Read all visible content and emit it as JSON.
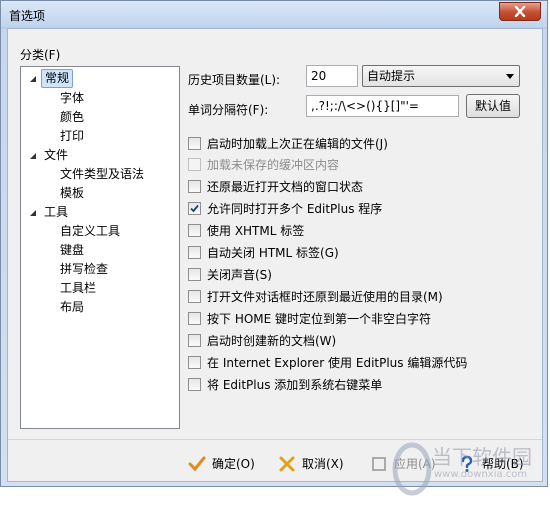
{
  "window": {
    "title": "首选项"
  },
  "category_label": "分类(F)",
  "tree": [
    {
      "label": "常规",
      "level": 0,
      "expanded": true,
      "selected": true
    },
    {
      "label": "字体",
      "level": 1
    },
    {
      "label": "颜色",
      "level": 1
    },
    {
      "label": "打印",
      "level": 1
    },
    {
      "label": "文件",
      "level": 0,
      "expanded": true
    },
    {
      "label": "文件类型及语法",
      "level": 1
    },
    {
      "label": "模板",
      "level": 1
    },
    {
      "label": "工具",
      "level": 0,
      "expanded": true
    },
    {
      "label": "自定义工具",
      "level": 1
    },
    {
      "label": "键盘",
      "level": 1
    },
    {
      "label": "拼写检查",
      "level": 1
    },
    {
      "label": "工具栏",
      "level": 1
    },
    {
      "label": "布局",
      "level": 1
    }
  ],
  "history": {
    "label": "历史项目数量(L):",
    "value": "20",
    "mode_selected": "自动提示"
  },
  "delimiters": {
    "label": "单词分隔符(F):",
    "value": ",.?!;:/\\<>(){}[]\"'=",
    "default_button": "默认值"
  },
  "options": [
    {
      "label": "启动时加载上次正在编辑的文件(J)",
      "checked": false,
      "disabled": false
    },
    {
      "label": "加载未保存的缓冲区内容",
      "checked": false,
      "disabled": true
    },
    {
      "label": "还原最近打开文档的窗口状态",
      "checked": false,
      "disabled": false
    },
    {
      "label": "允许同时打开多个 EditPlus 程序",
      "checked": true,
      "disabled": false
    },
    {
      "label": "使用 XHTML 标签",
      "checked": false,
      "disabled": false
    },
    {
      "label": "自动关闭 HTML 标签(G)",
      "checked": false,
      "disabled": false
    },
    {
      "label": "关闭声音(S)",
      "checked": false,
      "disabled": false
    },
    {
      "label": "打开文件对话框时还原到最近使用的目录(M)",
      "checked": false,
      "disabled": false
    },
    {
      "label": "按下 HOME 键时定位到第一个非空白字符",
      "checked": false,
      "disabled": false
    },
    {
      "label": "启动时创建新的文档(W)",
      "checked": false,
      "disabled": false
    },
    {
      "label": "在 Internet Explorer 使用 EditPlus 编辑源代码",
      "checked": false,
      "disabled": false
    },
    {
      "label": "将 EditPlus 添加到系统右键菜单",
      "checked": false,
      "disabled": false
    }
  ],
  "footer": {
    "ok": "确定(O)",
    "cancel": "取消(X)",
    "apply": "应用(A)",
    "help": "帮助(B)"
  },
  "watermark": {
    "line1": "当下软件园",
    "line2": "www.downxia.com"
  }
}
